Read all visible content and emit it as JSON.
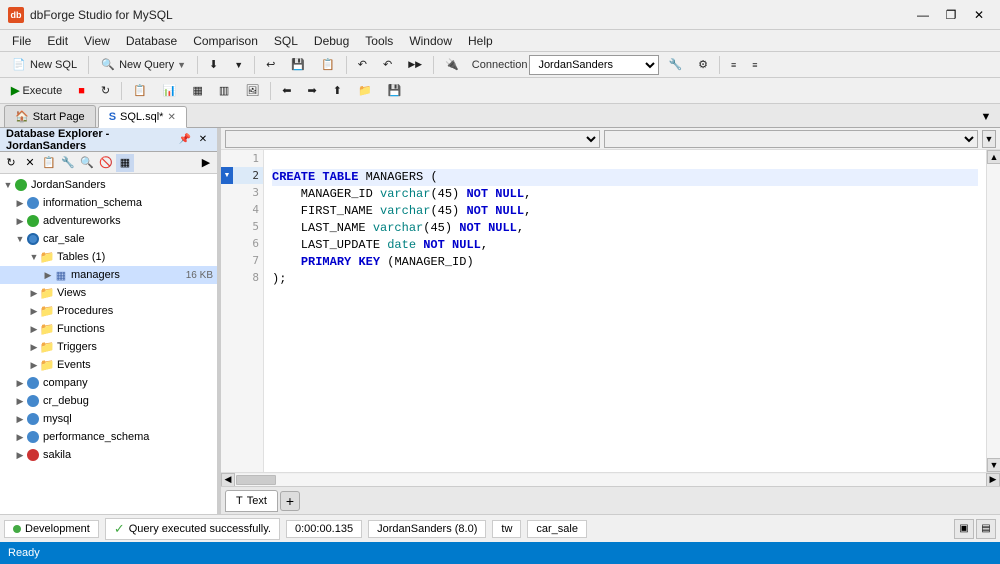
{
  "app": {
    "title": "dbForge Studio for MySQL",
    "icon_label": "db"
  },
  "title_controls": {
    "minimize": "—",
    "restore": "❐",
    "close": "✕"
  },
  "menu": {
    "items": [
      "File",
      "Edit",
      "View",
      "Database",
      "Comparison",
      "SQL",
      "Debug",
      "Tools",
      "Window",
      "Help"
    ]
  },
  "toolbar1": {
    "new_sql": "New SQL",
    "new_query": "New Query",
    "connection_label": "Connection",
    "connection_value": "JordanSanders"
  },
  "sidebar": {
    "title": "Database Explorer - JordanSanders",
    "close_btn": "✕",
    "pin_btn": "📌",
    "tree": [
      {
        "label": "JordanSanders",
        "type": "root",
        "expanded": true,
        "indent": 0
      },
      {
        "label": "information_schema",
        "type": "db-blue",
        "expanded": false,
        "indent": 1
      },
      {
        "label": "adventureworks",
        "type": "db-green",
        "expanded": false,
        "indent": 1
      },
      {
        "label": "car_sale",
        "type": "db-blue-expanded",
        "expanded": true,
        "indent": 1
      },
      {
        "label": "Tables (1)",
        "type": "folder",
        "expanded": true,
        "indent": 2
      },
      {
        "label": "managers",
        "type": "table",
        "expanded": false,
        "indent": 3,
        "size": "16 KB"
      },
      {
        "label": "Views",
        "type": "folder",
        "expanded": false,
        "indent": 2
      },
      {
        "label": "Procedures",
        "type": "folder",
        "expanded": false,
        "indent": 2
      },
      {
        "label": "Functions",
        "type": "folder",
        "expanded": false,
        "indent": 2
      },
      {
        "label": "Triggers",
        "type": "folder",
        "expanded": false,
        "indent": 2
      },
      {
        "label": "Events",
        "type": "folder",
        "expanded": false,
        "indent": 2
      },
      {
        "label": "company",
        "type": "db-blue",
        "expanded": false,
        "indent": 1
      },
      {
        "label": "cr_debug",
        "type": "db-blue",
        "expanded": false,
        "indent": 1
      },
      {
        "label": "mysql",
        "type": "db-blue",
        "expanded": false,
        "indent": 1
      },
      {
        "label": "performance_schema",
        "type": "db-blue",
        "expanded": false,
        "indent": 1
      },
      {
        "label": "sakila",
        "type": "db-red",
        "expanded": false,
        "indent": 1
      }
    ]
  },
  "tabs": {
    "items": [
      {
        "label": "Start Page",
        "active": false,
        "closable": false,
        "icon": "home"
      },
      {
        "label": "SQL.sql*",
        "active": true,
        "closable": true,
        "icon": "sql"
      }
    ]
  },
  "editor": {
    "lines": [
      {
        "num": 1,
        "content": "",
        "tokens": []
      },
      {
        "num": 2,
        "content": "CREATE TABLE MANAGERS (",
        "tokens": [
          {
            "text": "CREATE",
            "class": "kw"
          },
          {
            "text": " ",
            "class": ""
          },
          {
            "text": "TABLE",
            "class": "kw"
          },
          {
            "text": " MANAGERS (",
            "class": ""
          }
        ]
      },
      {
        "num": 3,
        "content": "    MANAGER_ID varchar(45) NOT NULL,",
        "tokens": [
          {
            "text": "    MANAGER_ID ",
            "class": ""
          },
          {
            "text": "varchar",
            "class": "type-name"
          },
          {
            "text": "(45) ",
            "class": ""
          },
          {
            "text": "NOT",
            "class": "kw"
          },
          {
            "text": " ",
            "class": ""
          },
          {
            "text": "NULL",
            "class": "kw"
          },
          {
            "text": ",",
            "class": ""
          }
        ]
      },
      {
        "num": 4,
        "content": "    FIRST_NAME varchar(45) NOT NULL,",
        "tokens": [
          {
            "text": "    FIRST_NAME ",
            "class": ""
          },
          {
            "text": "varchar",
            "class": "type-name"
          },
          {
            "text": "(45) ",
            "class": ""
          },
          {
            "text": "NOT",
            "class": "kw"
          },
          {
            "text": " ",
            "class": ""
          },
          {
            "text": "NULL",
            "class": "kw"
          },
          {
            "text": ",",
            "class": ""
          }
        ]
      },
      {
        "num": 5,
        "content": "    LAST_NAME varchar(45) NOT NULL,",
        "tokens": [
          {
            "text": "    LAST_NAME ",
            "class": ""
          },
          {
            "text": "varchar",
            "class": "type-name"
          },
          {
            "text": "(45) ",
            "class": ""
          },
          {
            "text": "NOT",
            "class": "kw"
          },
          {
            "text": " ",
            "class": ""
          },
          {
            "text": "NULL",
            "class": "kw"
          },
          {
            "text": ",",
            "class": ""
          }
        ]
      },
      {
        "num": 6,
        "content": "    LAST_UPDATE date NOT NULL,",
        "tokens": [
          {
            "text": "    LAST_UPDATE ",
            "class": ""
          },
          {
            "text": "date",
            "class": "type-name"
          },
          {
            "text": " ",
            "class": ""
          },
          {
            "text": "NOT",
            "class": "kw"
          },
          {
            "text": " ",
            "class": ""
          },
          {
            "text": "NULL",
            "class": "kw"
          },
          {
            "text": ",",
            "class": ""
          }
        ]
      },
      {
        "num": 7,
        "content": "    PRIMARY KEY (MANAGER_ID)",
        "tokens": [
          {
            "text": "    ",
            "class": ""
          },
          {
            "text": "PRIMARY",
            "class": "kw"
          },
          {
            "text": " ",
            "class": ""
          },
          {
            "text": "KEY",
            "class": "kw"
          },
          {
            "text": " (MANAGER_ID)",
            "class": ""
          }
        ]
      },
      {
        "num": 8,
        "content": ");",
        "tokens": [
          {
            "text": ")",
            "class": ""
          },
          {
            "text": ";",
            "class": ""
          }
        ]
      }
    ]
  },
  "bottom_tabs": [
    {
      "label": "Text",
      "active": true,
      "icon": "text"
    }
  ],
  "info_bar": {
    "dot_icon": "●",
    "environment": "Development",
    "status_icon": "✓",
    "status_text": "Query executed successfully.",
    "time": "0:00:00.135",
    "connection": "JordanSanders (8.0)",
    "charset": "tw",
    "database": "car_sale"
  },
  "status_bar": {
    "text": "Ready"
  },
  "icons": {
    "new_sql": "📄",
    "new_query": "🔍",
    "execute": "▶",
    "stop": "■",
    "refresh": "↻",
    "save": "💾",
    "undo": "↩",
    "redo": "↪",
    "home": "🏠",
    "sql": "S",
    "search": "🔍",
    "connection_icon": "🔌",
    "text_icon": "T"
  }
}
